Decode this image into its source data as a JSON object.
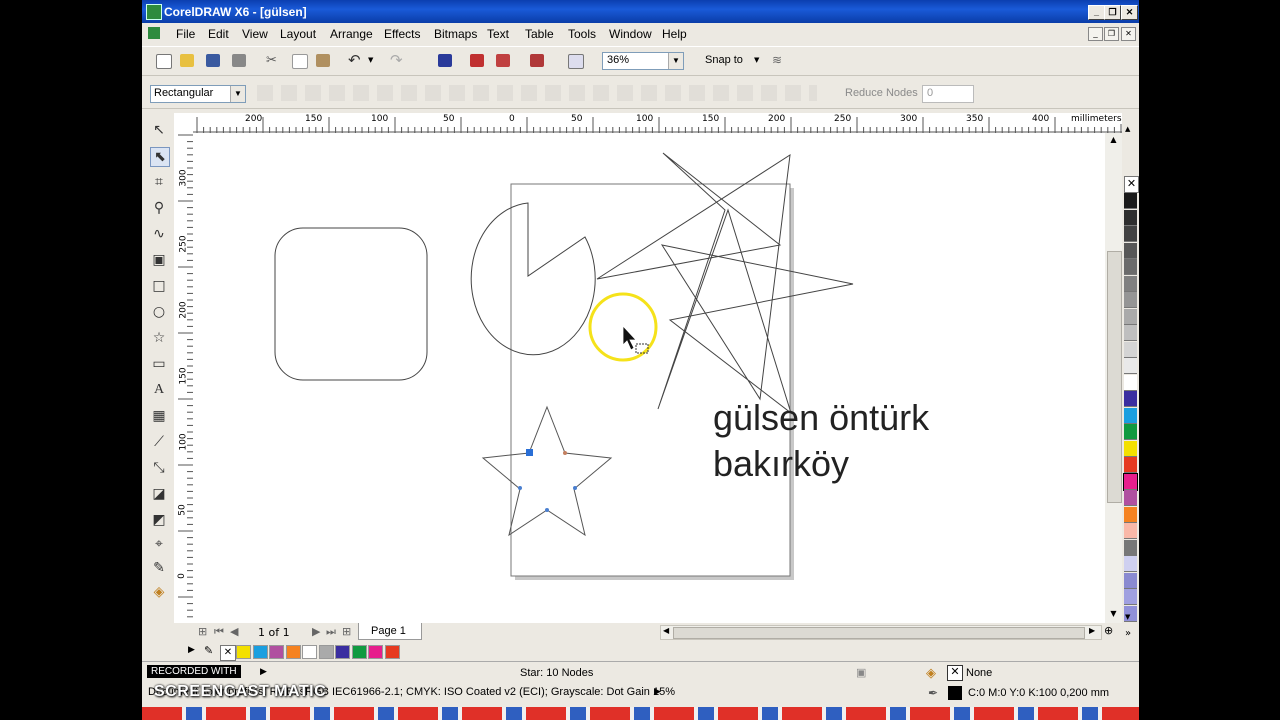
{
  "window": {
    "title": "CorelDRAW X6 - [gülsen]"
  },
  "menu": [
    "File",
    "Edit",
    "View",
    "Layout",
    "Arrange",
    "Effects",
    "Bitmaps",
    "Text",
    "Table",
    "Tools",
    "Window",
    "Help"
  ],
  "toolbar": {
    "zoom": "36%",
    "snap_to": "Snap to"
  },
  "property_bar": {
    "selection_mode": "Rectangular",
    "reduce_nodes_label": "Reduce Nodes",
    "reduce_nodes_value": "0"
  },
  "ruler": {
    "unit": "millimeters",
    "h_ticks": [
      "200",
      "150",
      "100",
      "50",
      "0",
      "50",
      "100",
      "150",
      "200",
      "250",
      "300",
      "350",
      "400"
    ],
    "v_ticks": [
      "300",
      "250",
      "200",
      "150",
      "100",
      "50",
      "0"
    ]
  },
  "canvas": {
    "text_line1": "gülsen öntürk",
    "text_line2": "bakırköy"
  },
  "navigator": {
    "page_count": "1 of 1",
    "page_tab": "Page 1"
  },
  "status": {
    "object_info": "Star: 10 Nodes",
    "color_profile": "Document color profiles: RGB: sRGB IEC61966-2.1; CMYK: ISO Coated v2 (ECI); Grayscale: Dot Gain 15%",
    "fill_label": "None",
    "outline_label": "C:0 M:0 Y:0 K:100  0,200 mm"
  },
  "watermark": {
    "badge": "RECORDED WITH",
    "brand": "SCREENCAST MATIC"
  },
  "palette_colors": [
    "#1a1a1a",
    "#2e2e2e",
    "#424242",
    "#575757",
    "#6b6b6b",
    "#808080",
    "#959595",
    "#aaaaaa",
    "#bfbfbf",
    "#d4d4d4",
    "#e9e9e9",
    "#ffffff",
    "#3a2ea0",
    "#1a9fe0",
    "#109a40",
    "#f3e000",
    "#e63a20",
    "#e61e8c",
    "#b050a0",
    "#f58220",
    "#f9b8a8",
    "#777777",
    "#cfd0f0",
    "#8a8ad0",
    "#a0a0e0",
    "#9090d8"
  ],
  "colorbar_colors": [
    "#f3e000",
    "#1a9fe0",
    "#b050a0",
    "#f58220",
    "#ffffff",
    "#aaaaaa",
    "#3a2ea0",
    "#109a40",
    "#e61e8c",
    "#e63a20"
  ]
}
